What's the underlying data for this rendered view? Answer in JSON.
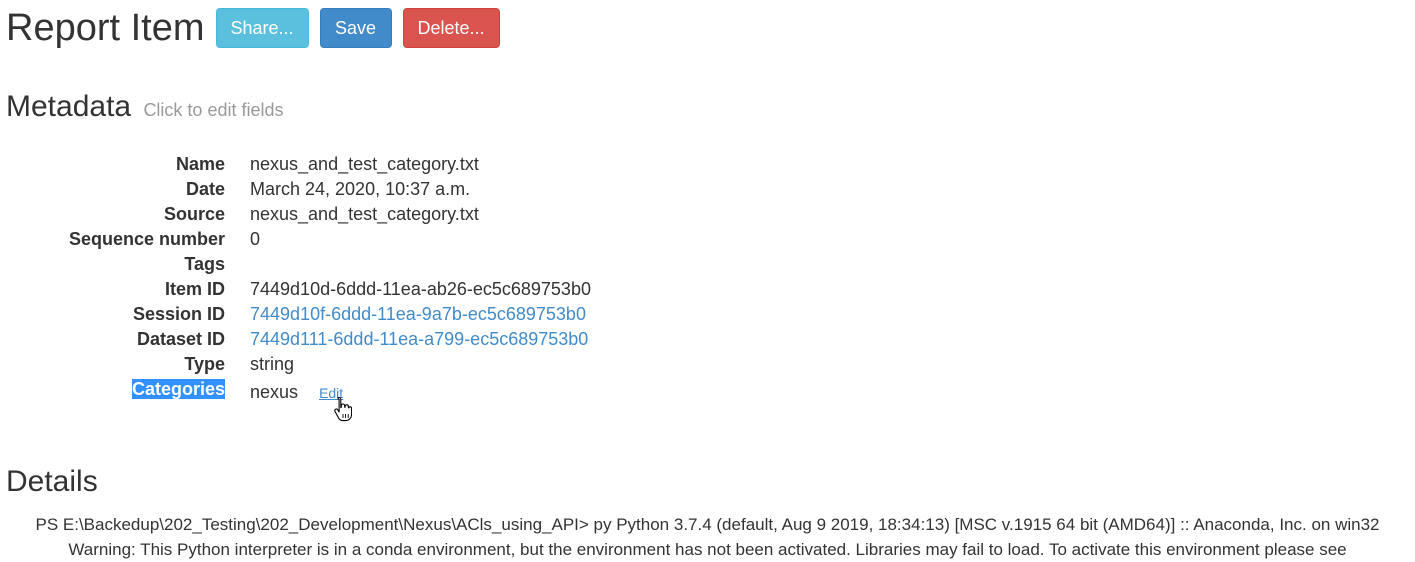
{
  "header": {
    "title": "Report Item",
    "share_label": "Share...",
    "save_label": "Save",
    "delete_label": "Delete..."
  },
  "metadata": {
    "title": "Metadata",
    "hint": "Click to edit fields",
    "rows": [
      {
        "label": "Name",
        "value": "nexus_and_test_category.txt"
      },
      {
        "label": "Date",
        "value": "March 24, 2020, 10:37 a.m."
      },
      {
        "label": "Source",
        "value": "nexus_and_test_category.txt"
      },
      {
        "label": "Sequence number",
        "value": "0"
      },
      {
        "label": "Tags",
        "value": ""
      },
      {
        "label": "Item ID",
        "value": "7449d10d-6ddd-11ea-ab26-ec5c689753b0"
      },
      {
        "label": "Session ID",
        "value": "7449d10f-6ddd-11ea-9a7b-ec5c689753b0"
      },
      {
        "label": "Dataset ID",
        "value": "7449d111-6ddd-11ea-a799-ec5c689753b0"
      },
      {
        "label": "Type",
        "value": "string"
      }
    ],
    "categories": {
      "label": "Categories",
      "value": "nexus",
      "edit_label": "Edit"
    }
  },
  "details": {
    "title": "Details",
    "lines": [
      "PS E:\\Backedup\\202_Testing\\202_Development\\Nexus\\ACls_using_API> py Python 3.7.4 (default, Aug 9 2019, 18:34:13) [MSC v.1915 64 bit (AMD64)] :: Anaconda, Inc. on win32",
      "Warning: This Python interpreter is in a conda environment, but the environment has not been activated. Libraries may fail to load. To activate this environment please see"
    ]
  },
  "colors": {
    "share": "#5bc0de",
    "save": "#428bca",
    "delete": "#d9534f",
    "link": "#428bca",
    "selection": "#3390ff"
  },
  "icons": {
    "cursor": "hand-pointer-icon"
  }
}
